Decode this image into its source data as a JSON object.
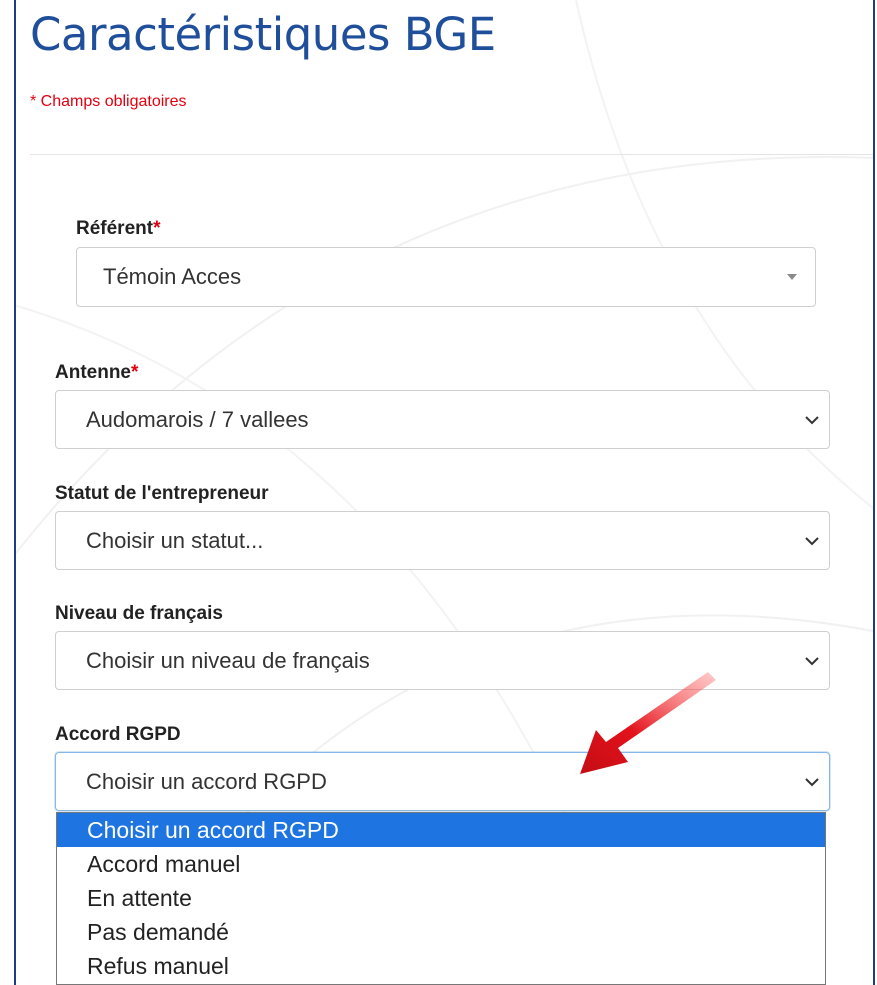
{
  "page": {
    "title": "Caractéristiques BGE",
    "required_note": "* Champs obligatoires"
  },
  "fields": {
    "referent": {
      "label": "Référent",
      "required_mark": "*",
      "value": "Témoin Acces"
    },
    "antenne": {
      "label": "Antenne",
      "required_mark": "*",
      "value": "Audomarois / 7 vallees"
    },
    "statut": {
      "label": "Statut de l'entrepreneur",
      "value": "Choisir un statut..."
    },
    "niveau_francais": {
      "label": "Niveau de français",
      "value": "Choisir un niveau de français"
    },
    "accord_rgpd": {
      "label": "Accord RGPD",
      "value": "Choisir un accord RGPD",
      "options": [
        "Choisir un accord RGPD",
        "Accord manuel",
        "En attente",
        "Pas demandé",
        "Refus manuel"
      ],
      "highlighted_option": 0
    }
  },
  "colors": {
    "title": "#1f4e9b",
    "required": "#e3000f",
    "frame_border": "#1c3c86",
    "option_highlight": "#1e74e0",
    "annotation_arrow": "#e3121b"
  },
  "icons": {
    "select_indicator": "chevron-down-icon",
    "referent_indicator": "caret-down-icon",
    "annotation": "red-arrow-icon"
  }
}
